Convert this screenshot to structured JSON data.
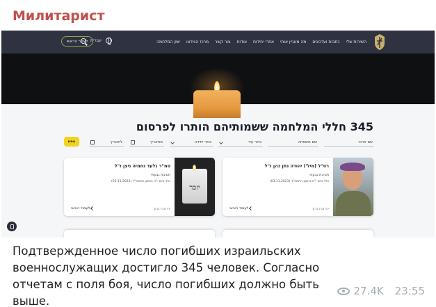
{
  "post": {
    "channel_name": "Милитарист",
    "caption": "Подтвержденное число погибших израильских военнослужащих достигло 345 человек. Согласно отчетам с поля боя, число погибших должно быть выше.",
    "views": "27.4K",
    "time": "23:55"
  },
  "site": {
    "nav_items": [
      "השירות שלי",
      "כתבות ועדכונים",
      "מה מעניין אותי",
      "אתרי יחידות",
      "אודות",
      "צור קשר",
      "מרכז הווידאו",
      "יומן המלחמה"
    ],
    "language": "עברית",
    "main_site_button": "לאתר הראשי",
    "heading": "345 חללי המלחמה ששמותיהם הותרו לפרסום",
    "filters": {
      "first_name": "שם פרטי",
      "last_name": "שם משפחה",
      "city": "בחר עיר",
      "unit": "בחר יחידה",
      "from_date": "מתאריך",
      "to_date": "לתאריך",
      "search_button": "חפש"
    },
    "soldiers": [
      {
        "name": "רס\"ל (מיל') יהודה נתן כהן ז\"ל",
        "unit": "חטיבת גבעתי",
        "date": "נפל ביום י\"ח בחשון התשפ\"ד (03.11.2023)",
        "footer": "יהי זכרו ברוך",
        "link": "לעמוד האישי"
      },
      {
        "name": "סמ\"ר גלעד נחמיה ניצן ז\"ל",
        "unit": "חטיבת גבעתי",
        "date": "נפל ביום י\"ח בחשון התשפ\"ד (03.11.2023)",
        "footer": "יהי זכרו ברוך",
        "link": "לעמוד האישי",
        "memorial_text": "יזכר"
      }
    ]
  }
}
